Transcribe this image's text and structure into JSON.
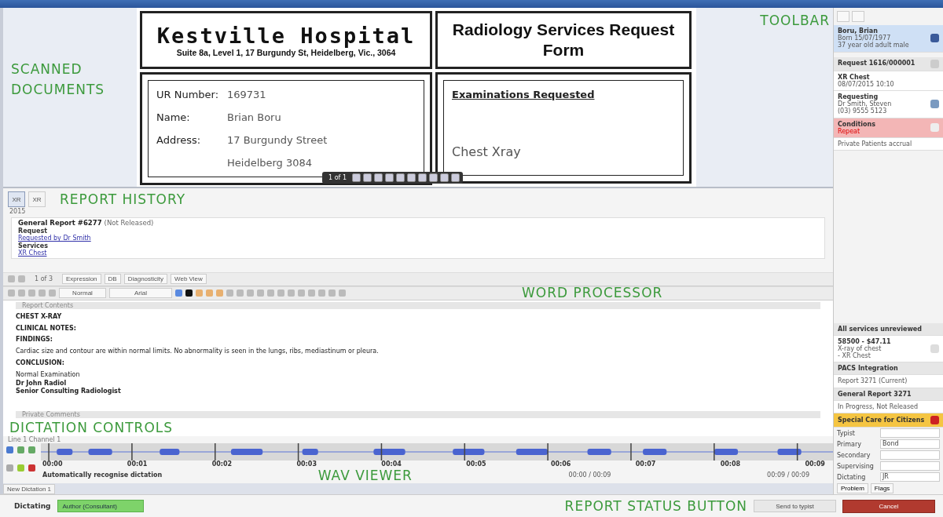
{
  "scanned_documents": {
    "annotation": "SCANNED DOCUMENTS",
    "hospital": "Kestville Hospital",
    "address": "Suite 8a, Level 1, 17 Burgundy St, Heidelberg, Vic., 3064",
    "form_title": "Radiology Services Request Form",
    "fields": [
      {
        "label": "UR Number:",
        "value": "169731"
      },
      {
        "label": "Name:",
        "value": "Brian Boru"
      },
      {
        "label": "Address:",
        "value": "17 Burgundy Street"
      }
    ],
    "address_line_2": "Heidelberg 3084",
    "exams_heading": "Examinations Requested",
    "exam": "Chest Xray",
    "page": "1 of 1"
  },
  "toolbar_annotation": "TOOLBAR",
  "report_history": {
    "annotation": "REPORT HISTORY",
    "tabs": [
      {
        "label": "XR",
        "selected": true
      },
      {
        "label": "XR",
        "selected": false
      }
    ],
    "year": "2015",
    "entry": {
      "title": "General Report #6277",
      "status": "(Not Released)",
      "request_label": "Request",
      "request": "Requested by Dr Smith",
      "services_label": "Services",
      "service": "XR Chest"
    },
    "page": "1 of 3",
    "toolbar_items": [
      "Expression",
      "DB",
      "Diagnosticity",
      "Web View"
    ]
  },
  "word_processor": {
    "annotation": "WORD PROCESSOR",
    "style": "Normal",
    "font": "Arial",
    "section": "Report Contents",
    "footer_section": "Private Comments",
    "lines": [
      {
        "kind": "heading",
        "text": "CHEST X-RAY"
      },
      {
        "kind": "heading",
        "text": "CLINICAL NOTES:"
      },
      {
        "kind": "heading",
        "text": "FINDINGS:"
      },
      {
        "kind": "body",
        "text": "Cardiac size and contour are within normal limits. No abnormality is seen in the lungs, ribs, mediastinum or pleura."
      },
      {
        "kind": "heading",
        "text": "CONCLUSION:"
      },
      {
        "kind": "body",
        "text": "Normal Examination"
      },
      {
        "kind": "signature",
        "text": "Dr John Radiol"
      },
      {
        "kind": "signature",
        "text": "Senior Consulting Radiologist"
      }
    ]
  },
  "dictation": {
    "annotation": "DICTATION CONTROLS",
    "wav_annotation": "WAV VIEWER",
    "label": "Line 1 Channel 1",
    "times": [
      "00:00",
      "00:01",
      "00:02",
      "00:03",
      "00:04",
      "00:05",
      "00:06",
      "00:07",
      "00:08",
      "00:09"
    ],
    "mode": "Automatically recognise dictation",
    "position": "00:00 / 00:09",
    "duration": "00:09 / 00:09",
    "tab": "New Dictation 1"
  },
  "status_bar": {
    "state": "Dictating",
    "role": "Author (Consultant)",
    "annotation": "REPORT STATUS BUTTON",
    "action": "Send to typist",
    "button": "Cancel"
  },
  "sidebar": {
    "patient": {
      "name": "Boru, Brian",
      "dob": "Born 15/07/1977",
      "age": "37 year old adult male"
    },
    "request": {
      "title": "Request 1616/000001",
      "exam": "XR Chest",
      "date": "08/07/2015 10:10",
      "requesting_label": "Requesting",
      "doctor": "Dr Smith, Steven",
      "phone": "(03) 9555 5123",
      "conditions_label": "Conditions",
      "condition": "Repeat",
      "billing": "Private Patients accrual"
    },
    "services": {
      "title": "All services unreviewed",
      "code": "58500 - $47.11",
      "exam": "X-ray of chest",
      "sub": "- XR Chest"
    },
    "pacs": {
      "title": "PACS Integration",
      "report": "Report 3271 (Current)"
    },
    "report": {
      "title": "General Report 3271",
      "status": "In Progress, Not Released",
      "alert": "Special Care for Citizens",
      "roles": [
        {
          "label": "Typist"
        },
        {
          "label": "Primary",
          "value": "Bond"
        },
        {
          "label": "Secondary"
        },
        {
          "label": "Supervising"
        },
        {
          "label": "Dictating",
          "value": "JR"
        }
      ],
      "buttons": [
        "Problem",
        "Flags"
      ]
    }
  }
}
